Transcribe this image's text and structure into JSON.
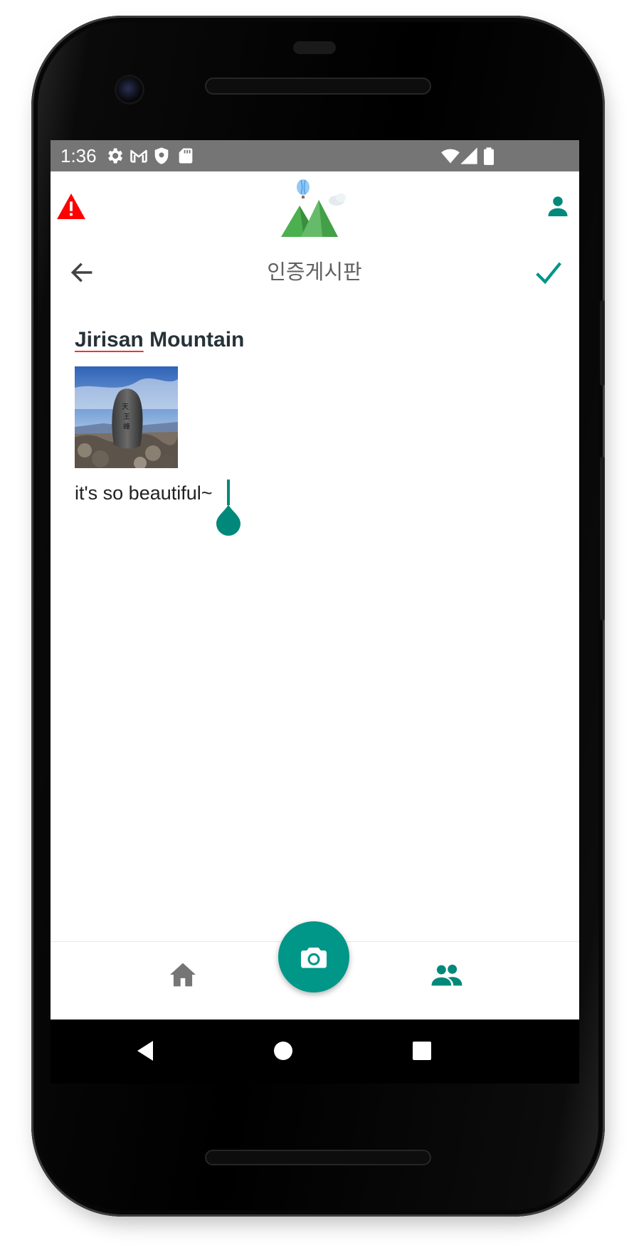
{
  "status_bar": {
    "time": "1:36",
    "left_icons": [
      "settings-icon",
      "gmail-icon",
      "shield-icon",
      "sd-card-icon"
    ],
    "right_icons": [
      "wifi-icon",
      "cell-signal-icon",
      "battery-icon"
    ]
  },
  "app_bar": {
    "left_icon": "warning-icon",
    "logo": "mountain-balloon-logo",
    "right_icon": "profile-icon"
  },
  "sub_header": {
    "title": "인증게시판",
    "back_icon": "back-arrow-icon",
    "confirm_icon": "check-icon"
  },
  "post": {
    "title_word1": "Jirisan",
    "title_word2": "Mountain",
    "photo": "summit-stone-photo",
    "body": "it's so beautiful~"
  },
  "bottom_nav": {
    "items": [
      "home-icon",
      "camera-icon",
      "community-icon"
    ],
    "active_item": "community-icon"
  },
  "colors": {
    "accent": "#009688",
    "warning": "#ff0000",
    "status_bar": "#757575",
    "inactive_icon": "#757575"
  }
}
